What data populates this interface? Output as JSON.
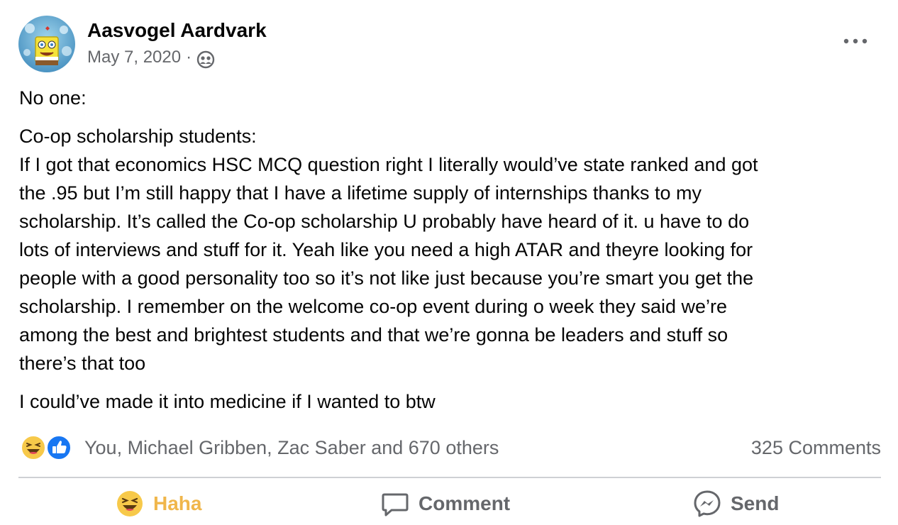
{
  "post": {
    "author": "Aasvogel Aardvark",
    "date": "May 7, 2020",
    "separator": "·",
    "audience_icon": "friends-icon",
    "more_icon": "more-options-icon",
    "paragraphs": [
      [
        "No one:"
      ],
      [
        "Co-op scholarship students:",
        "If I got that economics HSC MCQ question right I literally would’ve state ranked and got",
        "the .95 but I’m still happy that I have a lifetime supply of internships thanks to my",
        "scholarship. It’s called the Co-op scholarship U probably have heard of it. u have to do",
        "lots of interviews and stuff for it. Yeah like you need a high ATAR and theyre looking for",
        "people with a good personality too so it’s not like just because you’re smart you get the",
        "scholarship. I remember on the welcome co-op event during o week they said we’re",
        "among the best and brightest students and that we’re gonna be leaders and stuff so",
        "there’s that too"
      ],
      [
        "I could’ve made it into medicine if I wanted to btw"
      ]
    ]
  },
  "reactions": {
    "icons": [
      "haha-reaction-icon",
      "like-reaction-icon"
    ],
    "summary": "You, Michael Gribben, Zac Saber and 670 others",
    "comments": "325 Comments"
  },
  "actions": {
    "haha_label": "Haha",
    "comment_label": "Comment",
    "send_label": "Send"
  },
  "colors": {
    "haha_accent": "#f0b64b",
    "like_blue": "#1877f2",
    "secondary_text": "#65676b",
    "divider": "#ced0d4"
  }
}
